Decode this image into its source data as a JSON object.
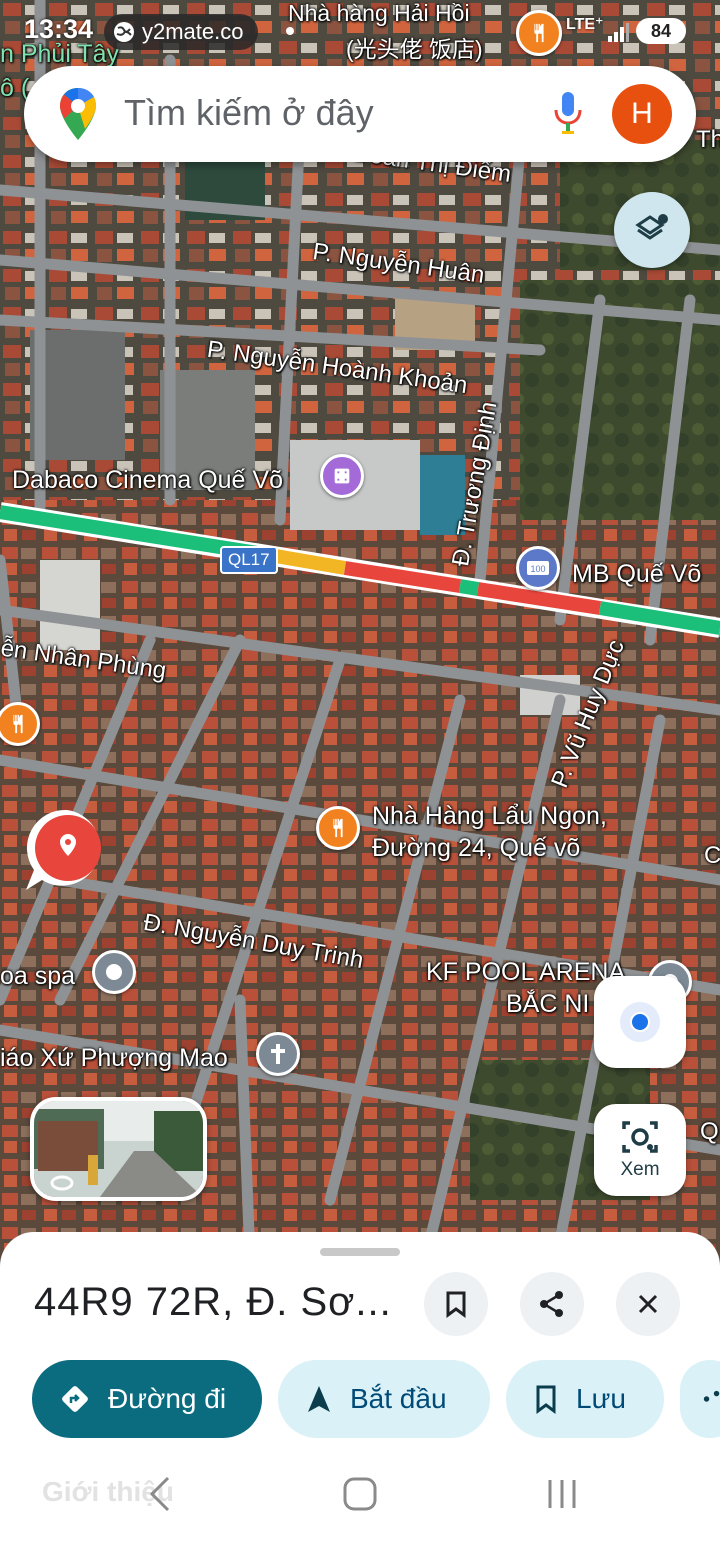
{
  "status_bar": {
    "time": "13:34",
    "tab_label": "y2mate.co",
    "network": "LTE⁺",
    "battery": "84"
  },
  "search": {
    "placeholder": "Tìm kiếm ở đây",
    "avatar_letter": "H"
  },
  "map": {
    "road_labels": {
      "doan_thi_diem": "Đoàn Thị Điểm",
      "nguyen_huan": "P. Nguyễn Huân",
      "nguyen_hoanh_khoan": "P. Nguyễn Hoành Khoản",
      "truong_dinh": "Đ. Trương Định",
      "ql17": "QL17",
      "nhan_phung": "ễn Nhân Phùng",
      "vu_huy_duc": "P. Vũ Huy Dực",
      "nguyen_duy_trinh": "Đ. Nguyễn Duy Trinh",
      "partial_q": "Q",
      "partial_c": "C",
      "partial_th": "Th"
    },
    "places": {
      "hai_hoi_1": "Nhà hàng Hải Hồi",
      "hai_hoi_2": "(光头佬 饭店)",
      "phui_tay": "n Phủi Tây",
      "phui_tay_2": "ô (",
      "dabaco": "Dabaco Cinema Quế Võ",
      "mb": "MB Quế Võ",
      "lau_ngon_1": "Nhà Hàng Lẩu Ngon,",
      "lau_ngon_2": "Đường 24, Quế võ",
      "pool_1": "KF POOL ARENA",
      "pool_2": "BẮC NI",
      "spa": "oa spa",
      "giao_xu": "iáo Xứ Phượng Mao"
    }
  },
  "controls": {
    "lens_label": "Xem"
  },
  "sheet": {
    "title": "44R9 72R, Đ. Sơ...",
    "chips": {
      "directions": "Đường đi",
      "start": "Bắt đầu",
      "save": "Lưu"
    },
    "faded_tab": "Giới thiệu"
  },
  "colors": {
    "primary_chip": "#0b6c80",
    "secondary_chip": "#d9f1f7",
    "pin_red": "#e8453c",
    "avatar": "#e8500f"
  }
}
